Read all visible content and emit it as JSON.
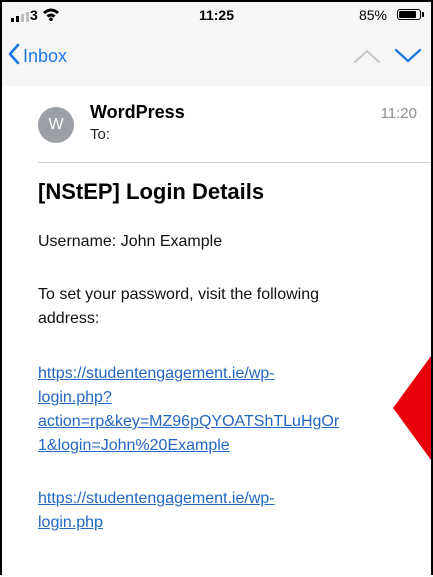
{
  "status_bar": {
    "carrier": "3",
    "time": "11:25",
    "battery": "85%",
    "battery_level": 0.85
  },
  "nav": {
    "back_label": "Inbox"
  },
  "email": {
    "avatar_initial": "W",
    "sender": "WordPress",
    "to_label": "To:",
    "time": "11:20",
    "subject": "[NStEP] Login Details",
    "username_line": "Username: John Example",
    "instruction_line1": "To set your password, visit the following",
    "instruction_line2": "address:",
    "reset_link_lines": [
      "https://studentengagement.ie/wp-",
      "login.php?",
      "action=rp&key=MZ96pQYOATShTLuHgOr",
      "1&login=John%20Example"
    ],
    "login_link_lines": [
      "https://studentengagement.ie/wp-",
      "login.php"
    ]
  },
  "colors": {
    "link": "#2367c2",
    "nav_accent": "#1d79e6",
    "annotation_arrow": "#e8000b"
  },
  "icons": [
    "signal-icon",
    "wifi-icon",
    "battery-icon",
    "chevron-left-icon",
    "chevron-up-icon",
    "chevron-down-icon",
    "red-arrow-annotation"
  ]
}
